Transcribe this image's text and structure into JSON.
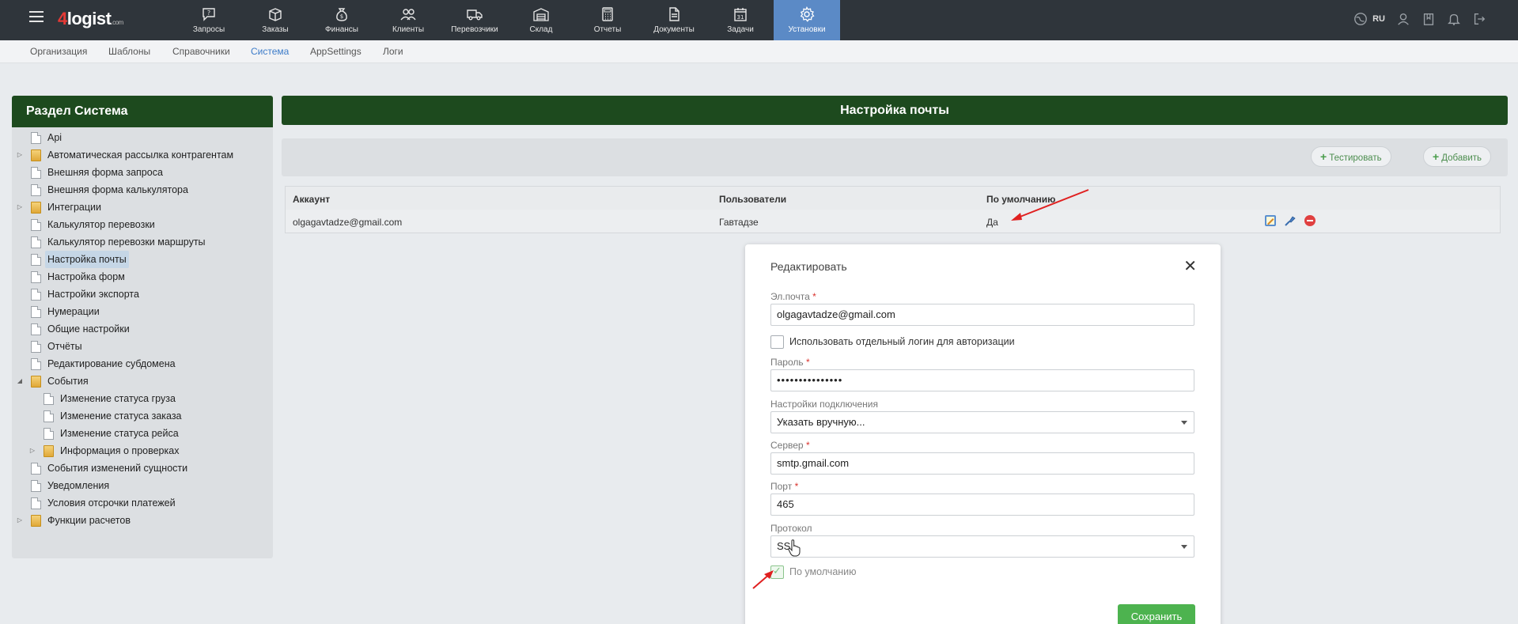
{
  "app": {
    "logo_num": "4",
    "logo_text": "logist",
    "logo_sub": ".com",
    "lang": "RU"
  },
  "nav": [
    {
      "label": "Запросы",
      "icon": "chat-question-icon",
      "active": false
    },
    {
      "label": "Заказы",
      "icon": "box-icon",
      "active": false
    },
    {
      "label": "Финансы",
      "icon": "money-bag-icon",
      "active": false
    },
    {
      "label": "Клиенты",
      "icon": "users-icon",
      "active": false
    },
    {
      "label": "Перевозчики",
      "icon": "truck-icon",
      "active": false
    },
    {
      "label": "Склад",
      "icon": "warehouse-icon",
      "active": false
    },
    {
      "label": "Отчеты",
      "icon": "calculator-icon",
      "active": false
    },
    {
      "label": "Документы",
      "icon": "document-icon",
      "active": false
    },
    {
      "label": "Задачи",
      "icon": "calendar-icon",
      "active": false
    },
    {
      "label": "Установки",
      "icon": "gear-icon",
      "active": true
    }
  ],
  "topright_icons": [
    "globe-icon",
    "user-icon",
    "book-icon",
    "bell-icon",
    "logout-icon"
  ],
  "submenu": [
    {
      "label": "Организация",
      "active": false
    },
    {
      "label": "Шаблоны",
      "active": false
    },
    {
      "label": "Справочники",
      "active": false
    },
    {
      "label": "Система",
      "active": true
    },
    {
      "label": "AppSettings",
      "active": false
    },
    {
      "label": "Логи",
      "active": false
    }
  ],
  "sidebar": {
    "title": "Раздел Система",
    "items": [
      {
        "label": "Api",
        "type": "file",
        "level": 0,
        "expander": ""
      },
      {
        "label": "Автоматическая рассылка контрагентам",
        "type": "folder",
        "level": 0,
        "expander": "▷"
      },
      {
        "label": "Внешняя форма запроса",
        "type": "file",
        "level": 0,
        "expander": ""
      },
      {
        "label": "Внешняя форма калькулятора",
        "type": "file",
        "level": 0,
        "expander": ""
      },
      {
        "label": "Интеграции",
        "type": "folder",
        "level": 0,
        "expander": "▷"
      },
      {
        "label": "Калькулятор перевозки",
        "type": "file",
        "level": 0,
        "expander": ""
      },
      {
        "label": "Калькулятор перевозки маршруты",
        "type": "file",
        "level": 0,
        "expander": ""
      },
      {
        "label": "Настройка почты",
        "type": "file",
        "level": 0,
        "expander": "",
        "selected": true
      },
      {
        "label": "Настройка форм",
        "type": "file",
        "level": 0,
        "expander": ""
      },
      {
        "label": "Настройки экспорта",
        "type": "file",
        "level": 0,
        "expander": ""
      },
      {
        "label": "Нумерации",
        "type": "file",
        "level": 0,
        "expander": ""
      },
      {
        "label": "Общие настройки",
        "type": "file",
        "level": 0,
        "expander": ""
      },
      {
        "label": "Отчёты",
        "type": "file",
        "level": 0,
        "expander": ""
      },
      {
        "label": "Редактирование субдомена",
        "type": "file",
        "level": 0,
        "expander": ""
      },
      {
        "label": "События",
        "type": "folder",
        "level": 0,
        "expander": "◢"
      },
      {
        "label": "Изменение статуса груза",
        "type": "file",
        "level": 1,
        "expander": ""
      },
      {
        "label": "Изменение статуса заказа",
        "type": "file",
        "level": 1,
        "expander": ""
      },
      {
        "label": "Изменение статуса рейса",
        "type": "file",
        "level": 1,
        "expander": ""
      },
      {
        "label": "Информация о проверках",
        "type": "folder",
        "level": 1,
        "expander": "▷"
      },
      {
        "label": "События изменений сущности",
        "type": "file",
        "level": 0,
        "expander": ""
      },
      {
        "label": "Уведомления",
        "type": "file",
        "level": 0,
        "expander": ""
      },
      {
        "label": "Условия отсрочки платежей",
        "type": "file",
        "level": 0,
        "expander": ""
      },
      {
        "label": "Функции расчетов",
        "type": "folder",
        "level": 0,
        "expander": "▷"
      }
    ]
  },
  "main": {
    "title": "Настройка почты",
    "toolbar": {
      "test_label": "Тестировать",
      "add_label": "Добавить"
    },
    "table": {
      "headers": [
        "Аккаунт",
        "Пользователи",
        "По умолчанию"
      ],
      "rows": [
        {
          "account": "olgagavtadze@gmail.com",
          "users": "Гавтадзе",
          "default": "Да"
        }
      ],
      "action_icons": [
        "edit-icon",
        "test-send-icon",
        "delete-icon"
      ]
    }
  },
  "modal": {
    "title": "Редактировать",
    "email_label": "Эл.почта",
    "email_value": "olgagavtadze@gmail.com",
    "separate_login_label": "Использовать отдельный логин для авторизации",
    "separate_login_checked": false,
    "password_label": "Пароль",
    "password_value": "•••••••••••••••",
    "connection_label": "Настройки подключения",
    "connection_value": "Указать вручную...",
    "server_label": "Сервер",
    "server_value": "smtp.gmail.com",
    "port_label": "Порт",
    "port_value": "465",
    "protocol_label": "Протокол",
    "protocol_value": "SSL",
    "default_label": "По умолчанию",
    "default_checked": true,
    "save_label": "Сохранить",
    "required_mark": "*"
  },
  "colors": {
    "topbar": "#2f353b",
    "active_nav": "#5b8ac6",
    "header_green": "#1d4a1e",
    "save_green": "#4db34f",
    "annotation_red": "#e02020"
  }
}
